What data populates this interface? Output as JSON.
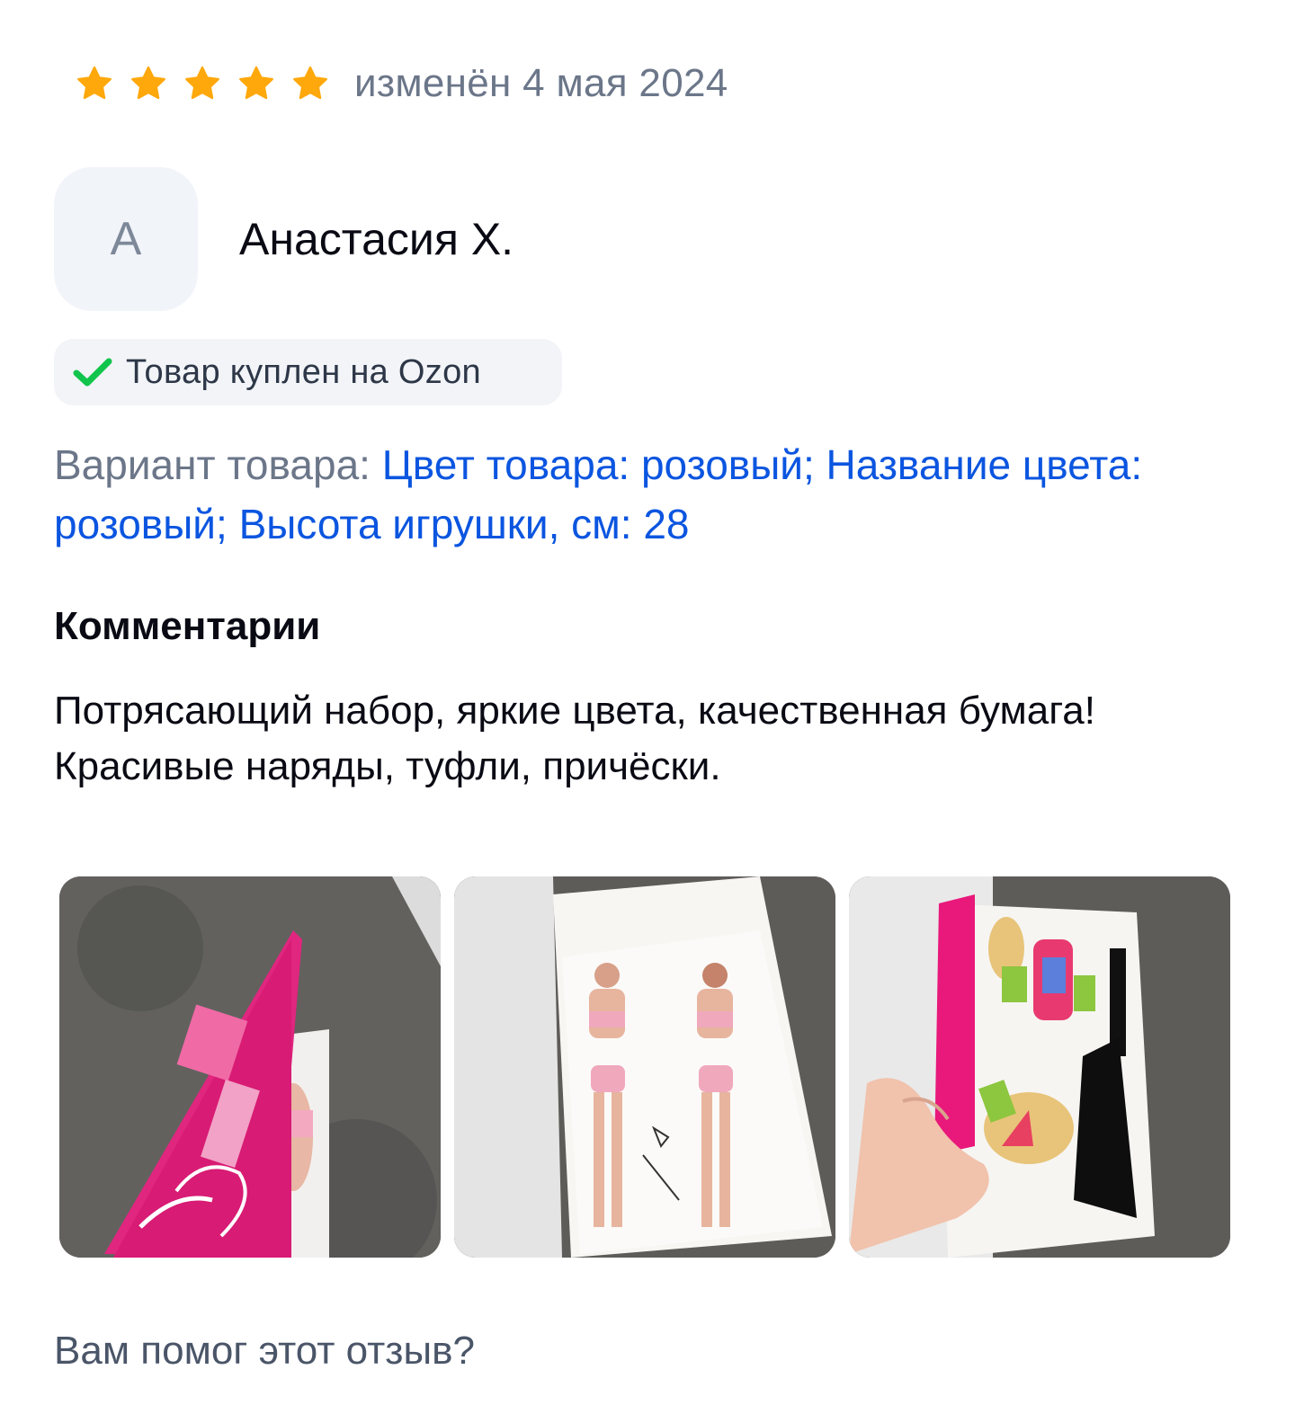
{
  "review": {
    "rating": 5,
    "stars": [
      "star-filled",
      "star-filled",
      "star-filled",
      "star-filled",
      "star-filled"
    ],
    "star_color": "#ffa80b",
    "date": "изменён 4 мая 2024"
  },
  "author": {
    "avatar_letter": "А",
    "name": "Анастасия Х."
  },
  "badge": {
    "icon": "check-icon",
    "icon_color": "#10c44c",
    "text": "Товар куплен на Ozon"
  },
  "variant": {
    "label": "Вариант товара: ",
    "value": "Цвет товара: розовый; Название цвета: розовый; Высота игрушки, см: 28",
    "value_color": "#0b55e0"
  },
  "comments": {
    "title": "Комментарии",
    "text": "Потрясающий набор, яркие цвета, качественная бумага! Красивые наряды, туфли, причёски."
  },
  "photos": [
    {
      "alt": "pink paper doll book cover"
    },
    {
      "alt": "doll figures page"
    },
    {
      "alt": "outfits and accessories page"
    }
  ],
  "helpful": {
    "question": "Вам помог этот отзыв?"
  }
}
